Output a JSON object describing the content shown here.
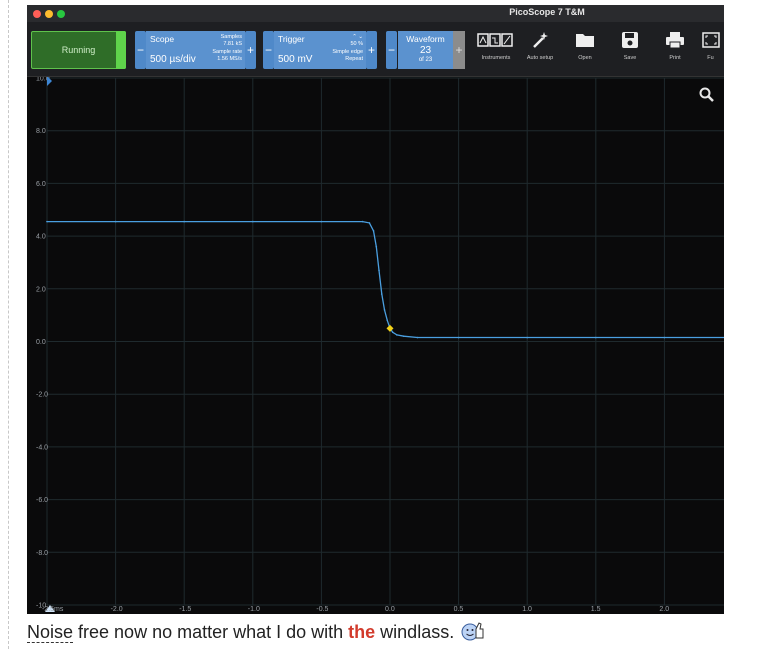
{
  "window": {
    "title": "PicoScope 7 T&M",
    "traffic_lights": [
      "#ff5f57",
      "#febc2e",
      "#28c840"
    ]
  },
  "toolbar": {
    "running_label": "Running",
    "scope": {
      "title": "Scope",
      "value": "500 µs/div",
      "samples_label": "Samples",
      "samples_value": "7.81 kS",
      "rate_label": "Sample rate",
      "rate_value": "1.56 MS/s"
    },
    "trigger": {
      "title": "Trigger",
      "value": "500 mV",
      "level": "50 %",
      "type": "Simple edge",
      "mode": "Repeat"
    },
    "waveform": {
      "title": "Waveform",
      "current": "23",
      "total": "of 23"
    },
    "minus": "−",
    "plus": "+",
    "tools": [
      {
        "label": "Instruments",
        "icon": "instruments-icon"
      },
      {
        "label": "Auto setup",
        "icon": "magic-wand-icon"
      },
      {
        "label": "Open",
        "icon": "folder-icon"
      },
      {
        "label": "Save",
        "icon": "save-icon"
      },
      {
        "label": "Print",
        "icon": "printer-icon"
      },
      {
        "label": "Fu",
        "icon": "fullscreen-icon"
      }
    ]
  },
  "chart_data": {
    "type": "line",
    "title": "",
    "xlabel": "",
    "ylabel": "",
    "xlim": [
      -2.5,
      2.5
    ],
    "ylim": [
      -10,
      10
    ],
    "x_ticks": [
      "-2.5ms",
      "-2.0",
      "-1.5",
      "-1.0",
      "-0.5",
      "0.0",
      "0.5",
      "1.0",
      "1.5",
      "2.0"
    ],
    "y_ticks": [
      "10.0",
      "8.0",
      "6.0",
      "4.0",
      "2.0",
      "0.0",
      "-2.0",
      "-4.0",
      "-6.0",
      "-8.0",
      "-10"
    ],
    "grid": true,
    "series": [
      {
        "color": "#4a9fe0",
        "x": [
          -2.5,
          -2.0,
          -1.5,
          -1.0,
          -0.5,
          -0.2,
          -0.15,
          -0.12,
          -0.1,
          -0.08,
          -0.06,
          -0.04,
          -0.02,
          0.0,
          0.02,
          0.05,
          0.1,
          0.2,
          0.5,
          1.0,
          1.5,
          2.0,
          2.5
        ],
        "y": [
          4.55,
          4.55,
          4.55,
          4.55,
          4.55,
          4.55,
          4.5,
          4.2,
          3.6,
          2.7,
          1.8,
          1.2,
          0.8,
          0.5,
          0.35,
          0.25,
          0.2,
          0.15,
          0.15,
          0.15,
          0.15,
          0.15,
          0.15
        ]
      }
    ],
    "trigger_marker": {
      "x": 0.0,
      "y": 0.5,
      "color": "#f2d21a"
    }
  },
  "caption": {
    "word1": "Noise",
    "middle": " free now no matter what I do with ",
    "highlight": "the",
    "end": " windlass."
  }
}
